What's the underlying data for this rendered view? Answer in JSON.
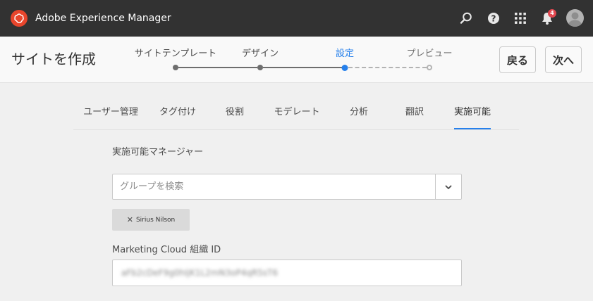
{
  "app": {
    "title": "Adobe Experience Manager",
    "notification_count": "4"
  },
  "wizard": {
    "title": "サイトを作成",
    "steps": [
      {
        "label": "サイトテンプレート",
        "state": "done"
      },
      {
        "label": "デザイン",
        "state": "done"
      },
      {
        "label": "設定",
        "state": "active"
      },
      {
        "label": "プレビュー",
        "state": "future"
      }
    ],
    "back_label": "戻る",
    "next_label": "次へ"
  },
  "tabs": {
    "items": [
      "ユーザー管理",
      "タグ付け",
      "役割",
      "モデレート",
      "分析",
      "翻訳",
      "実施可能"
    ],
    "selected": "実施可能"
  },
  "target": {
    "managers_label": "実施可能マネージャー",
    "search_placeholder": "グループを検索",
    "selected_tag": "Sirius Nilson",
    "org_id_label": "Marketing Cloud 組織 ID",
    "org_id_value": "aFb2cDeF9g0hIjK1L2mN3oP4qR5sT6"
  },
  "colors": {
    "topbar": "#323232",
    "logo": "#e8452c",
    "accent": "#2680eb",
    "badge": "#e34850"
  },
  "icons": [
    "adobe-logo-icon",
    "search-icon",
    "help-icon",
    "apps-grid-icon",
    "bell-icon",
    "user-avatar-icon",
    "chevron-down-icon",
    "close-icon"
  ]
}
